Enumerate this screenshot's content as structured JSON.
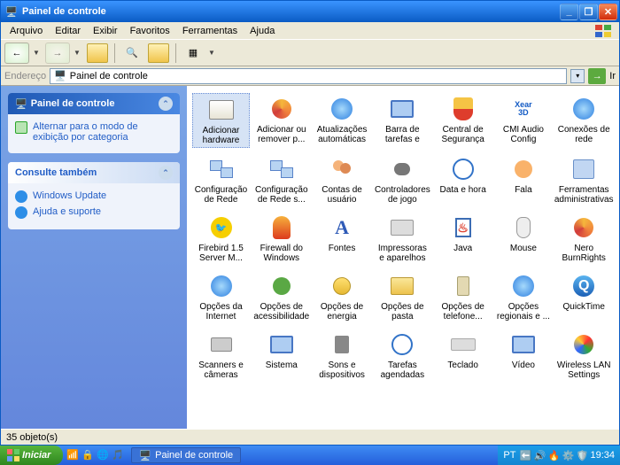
{
  "window": {
    "title": "Painel de controle"
  },
  "menu": [
    "Arquivo",
    "Editar",
    "Exibir",
    "Favoritos",
    "Ferramentas",
    "Ajuda"
  ],
  "address": {
    "label": "Endereço",
    "value": "Painel de controle",
    "go": "Ir"
  },
  "sidebar": {
    "main": {
      "title": "Painel de controle",
      "link": "Alternar para o modo de exibição por categoria"
    },
    "also": {
      "title": "Consulte também",
      "links": [
        "Windows Update",
        "Ajuda e suporte"
      ]
    }
  },
  "status": "35 objeto(s)",
  "taskbar": {
    "start": "Iniciar",
    "task": "Painel de controle",
    "lang": "PT",
    "time": "19:34"
  },
  "items": [
    {
      "label": "Adicionar hardware",
      "icon": "box",
      "sel": true
    },
    {
      "label": "Adicionar ou remover p...",
      "icon": "cd"
    },
    {
      "label": "Atualizações automáticas",
      "icon": "globe"
    },
    {
      "label": "Barra de tarefas e me...",
      "icon": "monitor"
    },
    {
      "label": "Central de Segurança",
      "icon": "shield"
    },
    {
      "label": "CMI Audio Config",
      "icon": "xear"
    },
    {
      "label": "Conexões de rede",
      "icon": "globe"
    },
    {
      "label": "Configuração de Rede",
      "icon": "net"
    },
    {
      "label": "Configuração de Rede s...",
      "icon": "net"
    },
    {
      "label": "Contas de usuário",
      "icon": "users"
    },
    {
      "label": "Controladores de jogo",
      "icon": "joy"
    },
    {
      "label": "Data e hora",
      "icon": "clock"
    },
    {
      "label": "Fala",
      "icon": "face"
    },
    {
      "label": "Ferramentas administrativas",
      "icon": "tools"
    },
    {
      "label": "Firebird 1.5 Server M...",
      "icon": "bird"
    },
    {
      "label": "Firewall do Windows",
      "icon": "flame"
    },
    {
      "label": "Fontes",
      "icon": "font"
    },
    {
      "label": "Impressoras e aparelhos d...",
      "icon": "printer"
    },
    {
      "label": "Java",
      "icon": "java"
    },
    {
      "label": "Mouse",
      "icon": "mouse"
    },
    {
      "label": "Nero BurnRights",
      "icon": "cd"
    },
    {
      "label": "Opções da Internet",
      "icon": "globe"
    },
    {
      "label": "Opções de acessibilidade",
      "icon": "accessibility"
    },
    {
      "label": "Opções de energia",
      "icon": "power"
    },
    {
      "label": "Opções de pasta",
      "icon": "folder"
    },
    {
      "label": "Opções de telefone...",
      "icon": "phone"
    },
    {
      "label": "Opções regionais e ...",
      "icon": "globe"
    },
    {
      "label": "QuickTime",
      "icon": "q"
    },
    {
      "label": "Scanners e câmeras",
      "icon": "camera"
    },
    {
      "label": "Sistema",
      "icon": "monitor"
    },
    {
      "label": "Sons e dispositivos ...",
      "icon": "speaker"
    },
    {
      "label": "Tarefas agendadas",
      "icon": "clock"
    },
    {
      "label": "Teclado",
      "icon": "key"
    },
    {
      "label": "Vídeo",
      "icon": "monitor"
    },
    {
      "label": "Wireless LAN Settings",
      "icon": "wifi"
    }
  ]
}
